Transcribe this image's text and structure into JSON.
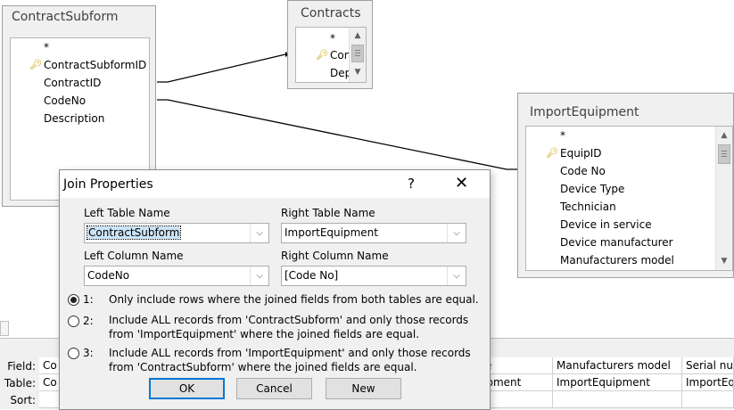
{
  "tables": {
    "contract_subform": {
      "title": "ContractSubform",
      "fields": [
        "*",
        "ContractSubformID",
        "ContractID",
        "CodeNo",
        "Description"
      ]
    },
    "contracts": {
      "title": "Contracts",
      "fields": [
        "*",
        "Con",
        "Dep"
      ]
    },
    "import_equipment": {
      "title": "ImportEquipment",
      "fields": [
        "*",
        "EquipID",
        "Code No",
        "Device Type",
        "Technician",
        "Device in service",
        "Device manufacturer",
        "Manufacturers model"
      ]
    }
  },
  "grid": {
    "row_labels": [
      "Field:",
      "Table:",
      "Sort:"
    ],
    "col1": {
      "field": "Co",
      "table": "Co"
    },
    "col2": {
      "field": "e",
      "table": "ipment"
    },
    "col3": {
      "field": "Manufacturers model",
      "table": "ImportEquipment"
    },
    "col4": {
      "field": "Serial nur",
      "table": "ImportEqu"
    }
  },
  "dialog": {
    "title": "Join Properties",
    "help": "?",
    "close": "✕",
    "left_table_label": "Left Table Name",
    "right_table_label": "Right Table Name",
    "left_table_value": "ContractSubform",
    "right_table_value": "ImportEquipment",
    "left_column_label": "Left Column Name",
    "right_column_label": "Right Column Name",
    "left_column_value": "CodeNo",
    "right_column_value": "[Code No]",
    "options": [
      {
        "num": "1:",
        "text": "Only include rows where the joined fields from both tables are equal.",
        "selected": true
      },
      {
        "num": "2:",
        "text": "Include ALL records from 'ContractSubform' and only those records from 'ImportEquipment' where the joined fields are equal.",
        "selected": false
      },
      {
        "num": "3:",
        "text": "Include ALL records from 'ImportEquipment' and only those records from 'ContractSubform' where the joined fields are equal.",
        "selected": false
      }
    ],
    "ok": "OK",
    "cancel": "Cancel",
    "new": "New"
  },
  "icons": {
    "key": "key-icon",
    "dropdown": "chevron-down-icon",
    "scroll_up": "arrow-up-icon",
    "scroll_down": "arrow-down-icon"
  },
  "colors": {
    "dialog_bg": "#f0f0f0",
    "selection": "#cce4f7",
    "default_button_border": "#0078d7"
  }
}
